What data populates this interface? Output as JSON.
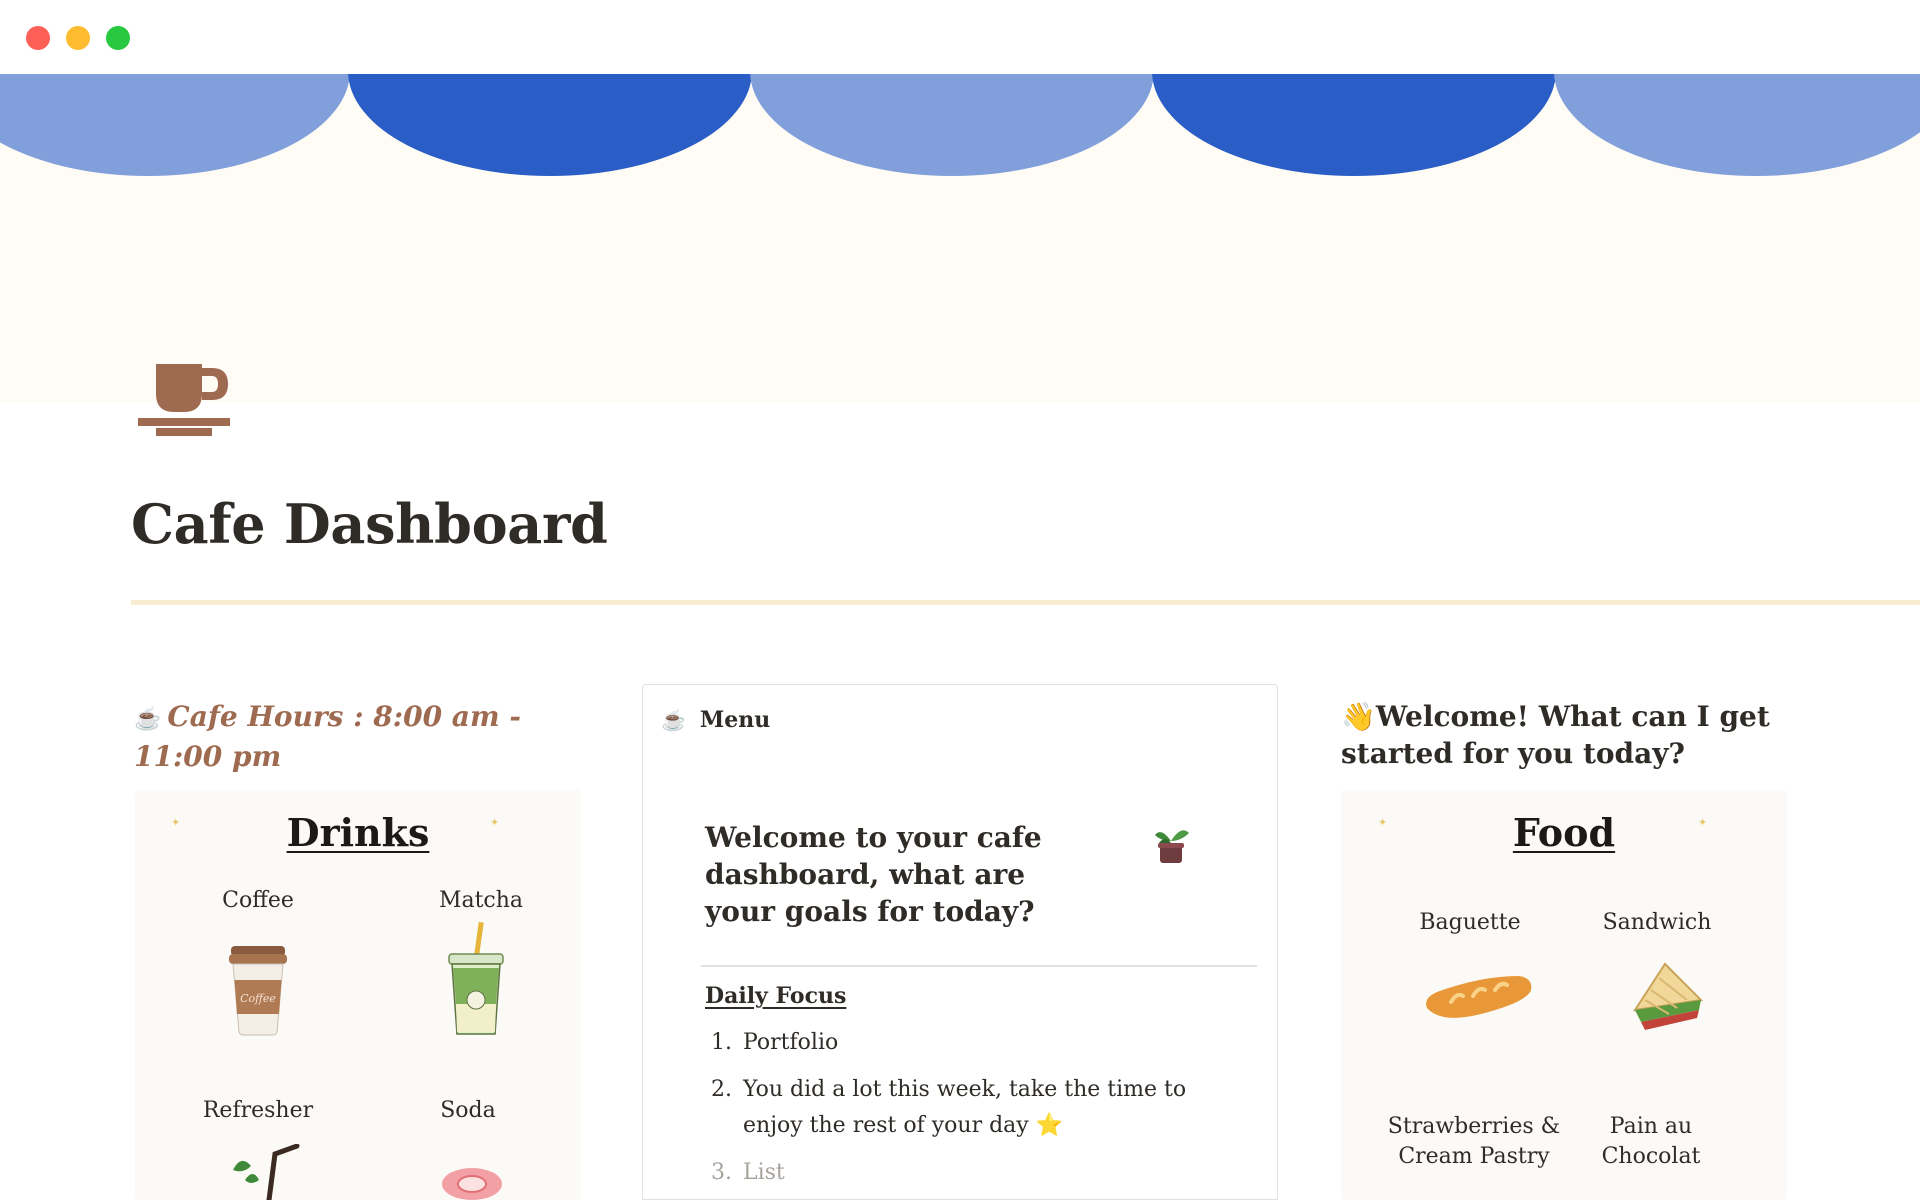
{
  "page": {
    "title": "Cafe Dashboard",
    "icon": "coffee-cup-icon"
  },
  "colors": {
    "cover_light_blue": "#809fdb",
    "cover_dark_blue": "#2a5dc5",
    "cover_background": "#fefcf4",
    "accent_brown": "#9e6a50",
    "title_rule": "#f6ecd2"
  },
  "hours": {
    "emoji": "☕",
    "text": "Cafe Hours : 8:00 am - 11:00 pm"
  },
  "drinks": {
    "title": "Drinks",
    "items": [
      {
        "label": "Coffee",
        "icon": "coffee-cup-icon"
      },
      {
        "label": "Matcha",
        "icon": "matcha-drink-icon"
      },
      {
        "label": "Refresher",
        "icon": "refresher-drink-icon"
      },
      {
        "label": "Soda",
        "icon": "soda-icon"
      }
    ]
  },
  "menu_card": {
    "emoji": "☕",
    "header": "Menu",
    "welcome": "Welcome to your cafe dashboard, what are your goals for today?",
    "plant_icon": "potted-plant-icon",
    "focus_title": "Daily Focus",
    "focus_items": [
      {
        "num": "1.",
        "text": "Portfolio"
      },
      {
        "num": "2.",
        "text": "You did a lot this week, take the time to enjoy the rest of your day ⭐"
      },
      {
        "num": "3.",
        "text": "List"
      }
    ]
  },
  "greeting": {
    "emoji": "👋",
    "text": "Welcome! What can I get started for you today?"
  },
  "food": {
    "title": "Food",
    "items": [
      {
        "label": "Baguette",
        "icon": "baguette-icon"
      },
      {
        "label": "Sandwich",
        "icon": "sandwich-icon"
      },
      {
        "label": "Strawberries & Cream Pastry",
        "icon": "pastry-icon"
      },
      {
        "label": "Pain au Chocolat",
        "icon": "croissant-icon"
      }
    ]
  }
}
